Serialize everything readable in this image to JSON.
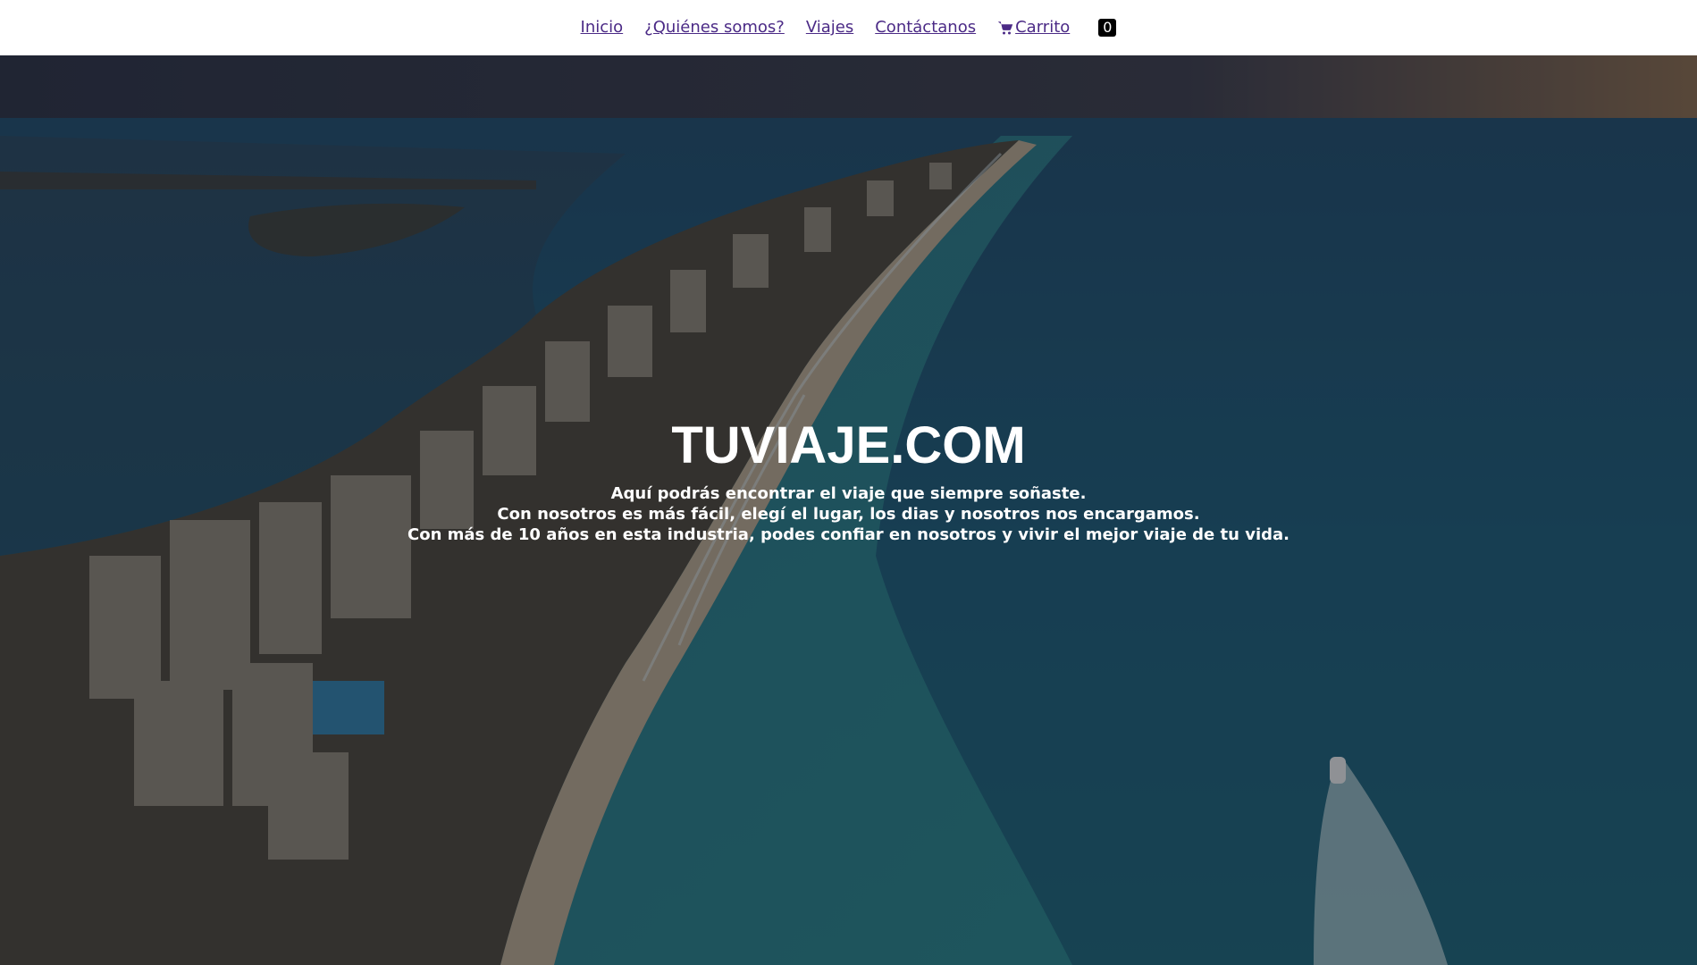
{
  "nav": {
    "items": [
      {
        "label": "Inicio"
      },
      {
        "label": "¿Quiénes somos?"
      },
      {
        "label": "Viajes"
      },
      {
        "label": "Contáctanos"
      }
    ],
    "cart": {
      "label": "Carrito ",
      "icon": "cart-icon",
      "count": "0"
    },
    "link_color": "#4b2a86"
  },
  "hero": {
    "title": "TUVIAJE.COM",
    "lines": [
      "Aquí podrás encontrar el viaje que siempre soñaste.",
      "Con nosotros es más fácil, elegí el lugar, los dias y nosotros nos encargamos.",
      "Con más de 10 años en esta industria, podes confiar en nosotros y vivir el mejor viaje de tu vida."
    ]
  }
}
